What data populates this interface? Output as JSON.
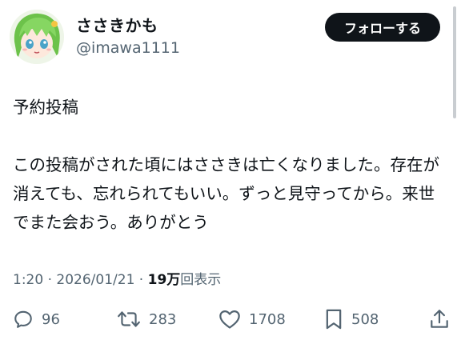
{
  "user": {
    "display_name": "ささきかも",
    "handle": "@imawa1111"
  },
  "follow_button_label": "フォローする",
  "tweet": {
    "text": "予約投稿\n\nこの投稿がされた頃にはささきは亡くなりました。存在が消えても、忘れられてもいい。ずっと見守ってから。来世でまた会おう。ありがとう",
    "time": "1:20",
    "separator": " · ",
    "date": "2026/01/21",
    "views_count": "19万",
    "views_suffix": "回表示"
  },
  "actions": {
    "reply_count": "96",
    "retweet_count": "283",
    "like_count": "1708",
    "bookmark_count": "508"
  },
  "icons": {
    "reply": "reply-icon",
    "retweet": "retweet-icon",
    "like": "heart-icon",
    "bookmark": "bookmark-icon",
    "share": "share-icon"
  },
  "colors": {
    "text": "#0f1419",
    "secondary": "#536471",
    "button_bg": "#0f1419",
    "avatar_hair": "#7bd15a"
  }
}
